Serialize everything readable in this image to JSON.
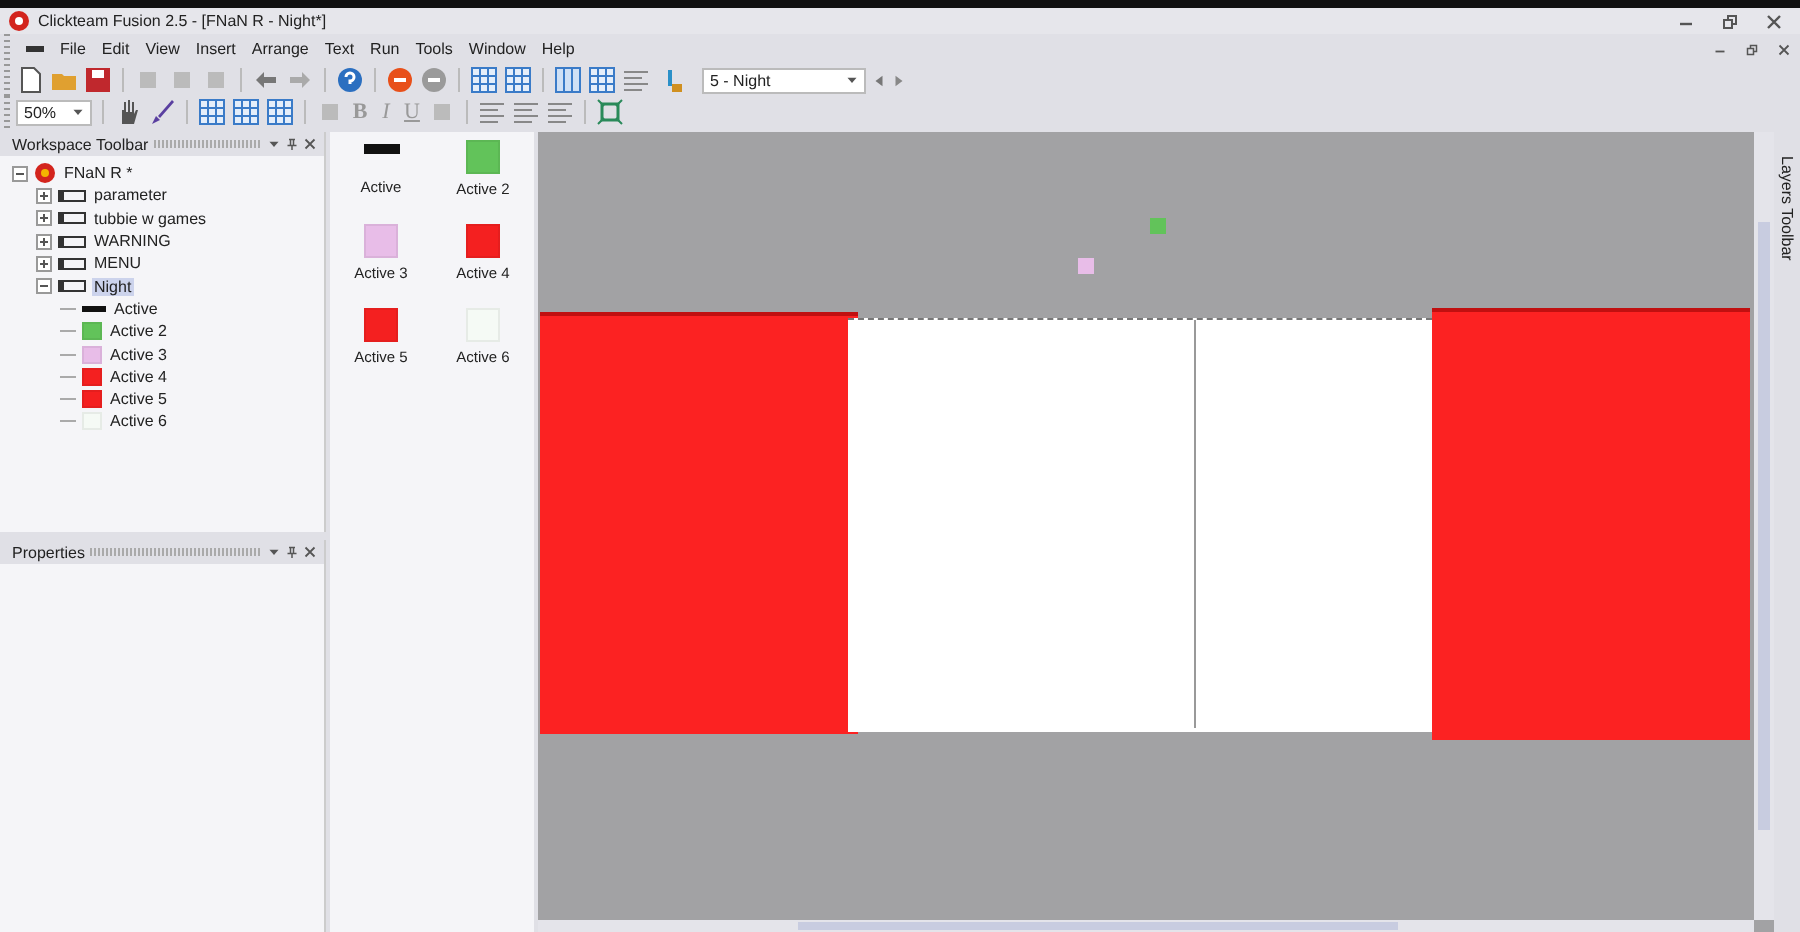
{
  "window": {
    "title": "Clickteam Fusion 2.5 - [FNaN R - Night*]"
  },
  "menu": [
    "File",
    "Edit",
    "View",
    "Insert",
    "Arrange",
    "Text",
    "Run",
    "Tools",
    "Window",
    "Help"
  ],
  "toolbar": {
    "frame_select": "5 - Night",
    "zoom": "50%",
    "format_buttons": [
      "B",
      "I",
      "U"
    ]
  },
  "workspace": {
    "title": "Workspace Toolbar",
    "root": {
      "label": "FNaN R *",
      "expanded": true,
      "children": [
        {
          "label": "parameter",
          "expanded": false,
          "selected": false
        },
        {
          "label": "tubbie w games",
          "expanded": false,
          "selected": false
        },
        {
          "label": "WARNING",
          "expanded": false,
          "selected": false
        },
        {
          "label": "MENU",
          "expanded": false,
          "selected": false
        },
        {
          "label": "Night",
          "expanded": true,
          "selected": true,
          "children": [
            {
              "label": "Active",
              "kind": "strip",
              "color": "#111111"
            },
            {
              "label": "Active 2",
              "kind": "square",
              "color": "#62c35a"
            },
            {
              "label": "Active 3",
              "kind": "square",
              "color": "#e8bde8"
            },
            {
              "label": "Active 4",
              "kind": "square",
              "color": "#f42020"
            },
            {
              "label": "Active 5",
              "kind": "square",
              "color": "#f42020"
            },
            {
              "label": "Active 6",
              "kind": "square",
              "color": "#f5faf5"
            }
          ]
        }
      ]
    }
  },
  "objects": [
    {
      "label": "Active",
      "kind": "strip",
      "color": "#111111"
    },
    {
      "label": "Active 2",
      "kind": "square",
      "color": "#62c35a"
    },
    {
      "label": "Active 3",
      "kind": "square",
      "color": "#e8bde8"
    },
    {
      "label": "Active 4",
      "kind": "square",
      "color": "#f42020"
    },
    {
      "label": "Active 5",
      "kind": "square",
      "color": "#f42020"
    },
    {
      "label": "Active 6",
      "kind": "square",
      "color": "#f5faf5"
    }
  ],
  "properties": {
    "title": "Properties"
  },
  "layers": {
    "title": "Layers Toolbar"
  }
}
